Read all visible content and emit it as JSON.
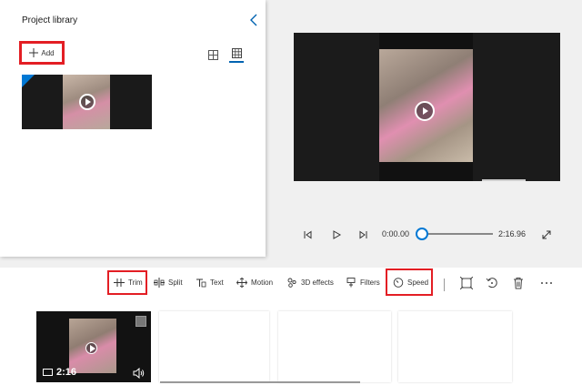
{
  "library": {
    "title": "Project library",
    "add_label": "Add"
  },
  "playback": {
    "current_time": "0:00.00",
    "total_time": "2:16.96",
    "progress": 0
  },
  "toolbar": {
    "trim_label": "Trim",
    "split_label": "Split",
    "text_label": "Text",
    "motion_label": "Motion",
    "effects3d_label": "3D effects",
    "filters_label": "Filters",
    "speed_label": "Speed"
  },
  "timeline": {
    "clip_duration": "2:16"
  },
  "colors": {
    "accent": "#0078d4",
    "highlight_box": "#e31e24"
  }
}
